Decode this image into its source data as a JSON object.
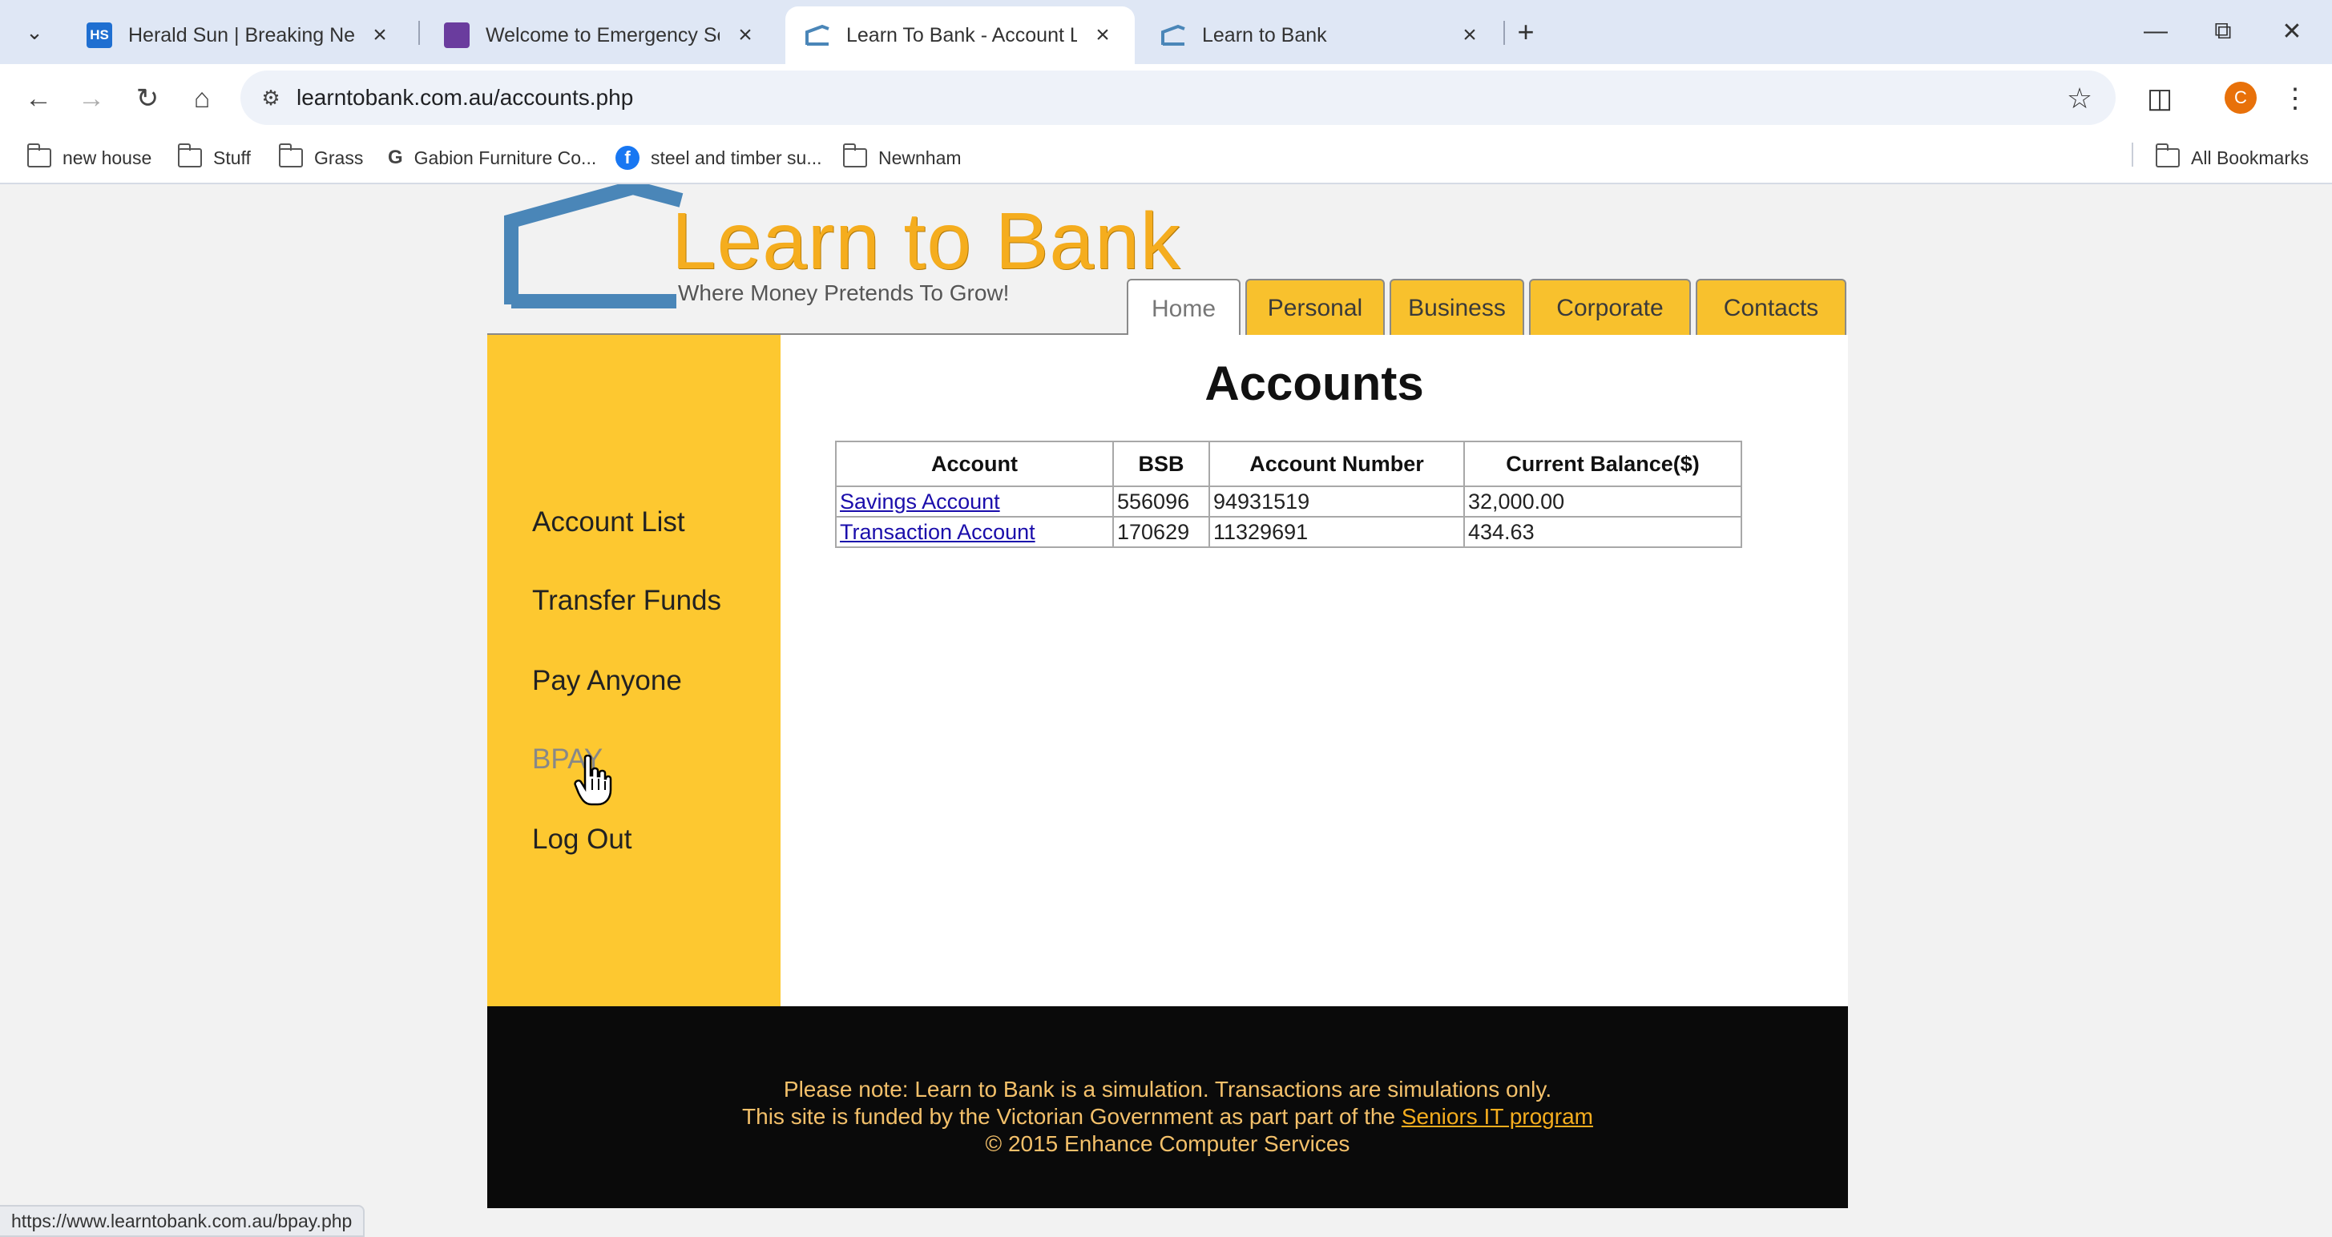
{
  "browser": {
    "tabs": [
      {
        "title": "Herald Sun | Breaking News an",
        "favicon_text": "HS",
        "favicon_color": "#1f6fd1"
      },
      {
        "title": "Welcome to Emergency Service",
        "favicon_text": "",
        "favicon_color": "#6a3c9e"
      },
      {
        "title": "Learn To Bank - Account List",
        "favicon_text": "",
        "favicon_color": "#4a86b8"
      },
      {
        "title": "Learn to Bank",
        "favicon_text": "",
        "favicon_color": "#4a86b8"
      }
    ],
    "active_tab": 2,
    "url": "learntobank.com.au/accounts.php",
    "profile_initial": "C",
    "bookmarks": [
      {
        "label": "new house",
        "icon": "folder-icon"
      },
      {
        "label": "Stuff",
        "icon": "folder-icon"
      },
      {
        "label": "Grass",
        "icon": "folder-icon"
      },
      {
        "label": "Gabion Furniture Co...",
        "icon": "google-icon"
      },
      {
        "label": "steel and timber su...",
        "icon": "facebook-icon"
      },
      {
        "label": "Newnham",
        "icon": "folder-icon"
      }
    ],
    "all_bookmarks": "All Bookmarks",
    "status_url": "https://www.learntobank.com.au/bpay.php"
  },
  "site": {
    "logo_title": "Learn to Bank",
    "tagline": "Where Money Pretends To Grow!",
    "nav": [
      "Home",
      "Personal",
      "Business",
      "Corporate",
      "Contacts"
    ],
    "active_nav": "Home",
    "sidebar": [
      "Account List",
      "Transfer Funds",
      "Pay Anyone",
      "BPAY",
      "Log Out"
    ],
    "hovered_sidebar": "BPAY",
    "page_title": "Accounts",
    "table": {
      "headers": [
        "Account",
        "BSB",
        "Account Number",
        "Current Balance($)"
      ],
      "rows": [
        {
          "account": "Savings Account",
          "bsb": "556096",
          "number": "94931519",
          "balance": "32,000.00"
        },
        {
          "account": "Transaction Account",
          "bsb": "170629",
          "number": "11329691",
          "balance": "434.63"
        }
      ]
    },
    "footer": {
      "line1": "Please note: Learn to Bank is a simulation.  Transactions are simulations only.",
      "line2_prefix": "This site is funded by the Victorian Government as part part of the ",
      "line2_link": "Seniors IT program",
      "line3": "© 2015 Enhance Computer Services"
    },
    "colors": {
      "brand_yellow": "#fdc830",
      "logo_orange": "#f5ad1e",
      "logo_house": "#4a86b8"
    }
  }
}
